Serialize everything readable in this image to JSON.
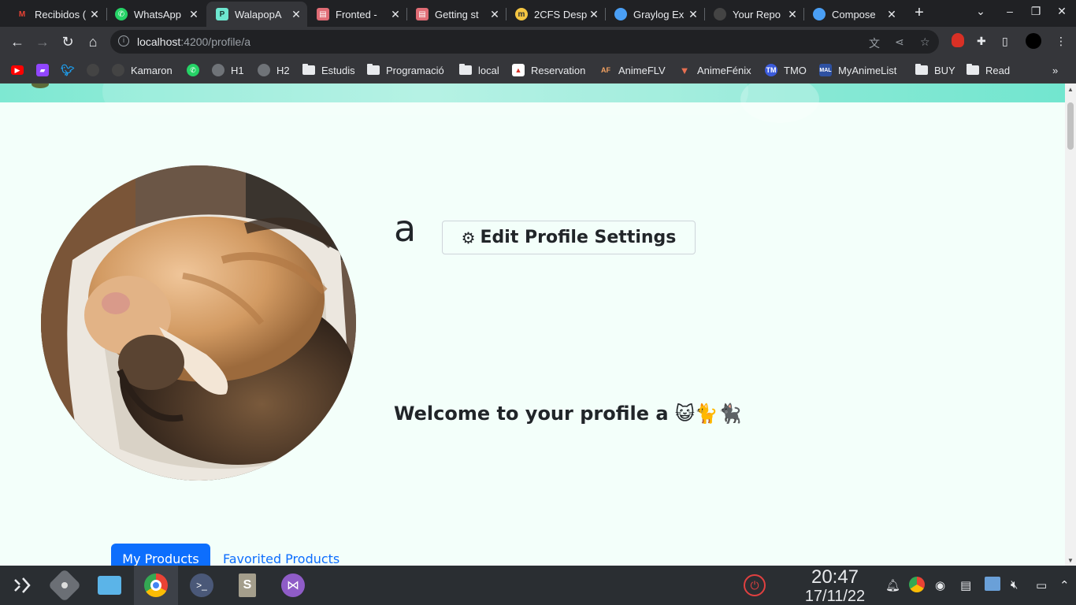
{
  "browser": {
    "tabs": [
      {
        "title": "Recibidos (",
        "icon": "gmail-icon",
        "color": "#ea4335",
        "active": false
      },
      {
        "title": "WhatsApp",
        "icon": "whatsapp-icon",
        "color": "#25d366",
        "active": false
      },
      {
        "title": "WalapopA",
        "icon": "walapop-icon",
        "color": "#6ee7d0",
        "active": true
      },
      {
        "title": "Fronted - ",
        "icon": "doc-icon",
        "color": "#e06c75",
        "active": false
      },
      {
        "title": "Getting st",
        "icon": "doc-icon",
        "color": "#e06c75",
        "active": false
      },
      {
        "title": "2CFS Desp",
        "icon": "moodle-icon",
        "color": "#f4c542",
        "active": false
      },
      {
        "title": "Graylog Ex",
        "icon": "compose-icon",
        "color": "#4a9ff5",
        "active": false
      },
      {
        "title": "Your Repo",
        "icon": "github-icon",
        "color": "#444444",
        "active": false
      },
      {
        "title": "Compose",
        "icon": "compose-icon",
        "color": "#4a9ff5",
        "active": false
      }
    ],
    "url_host": "localhost",
    "url_path": ":4200/profile/a"
  },
  "bookmarks": [
    {
      "label": "",
      "icon": "youtube-icon",
      "color": "#ff0000"
    },
    {
      "label": "",
      "icon": "twitch-icon",
      "color": "#9146ff"
    },
    {
      "label": "",
      "icon": "twitter-icon",
      "color": "#1da1f2"
    },
    {
      "label": "",
      "icon": "github-icon",
      "color": "#444444"
    },
    {
      "label": "Kamaron",
      "icon": "github-icon",
      "color": "#444444"
    },
    {
      "label": "",
      "icon": "whatsapp-icon",
      "color": "#25d366"
    },
    {
      "label": "H1",
      "icon": "globe-icon",
      "color": "#9aa0a6"
    },
    {
      "label": "H2",
      "icon": "globe-icon",
      "color": "#9aa0a6"
    },
    {
      "label": "Estudis",
      "icon": "folder-icon",
      "color": "#e8eaed"
    },
    {
      "label": "Programació",
      "icon": "folder-icon",
      "color": "#e8eaed"
    },
    {
      "label": "local",
      "icon": "folder-icon",
      "color": "#e8eaed"
    },
    {
      "label": "Reservation",
      "icon": "reservation-icon",
      "color": "#d93025"
    },
    {
      "label": "AnimeFLV",
      "icon": "animeflv-icon",
      "color": "#f4a261"
    },
    {
      "label": "AnimeFénix",
      "icon": "animefenix-icon",
      "color": "#e76f51"
    },
    {
      "label": "TMO",
      "icon": "tmo-icon",
      "color": "#3b5bdb"
    },
    {
      "label": "MyAnimeList",
      "icon": "mal-icon",
      "color": "#2e51a2"
    },
    {
      "label": "BUY",
      "icon": "folder-icon",
      "color": "#e8eaed"
    },
    {
      "label": "Read",
      "icon": "folder-icon",
      "color": "#e8eaed"
    }
  ],
  "profile": {
    "username": "a",
    "edit_button": "Edit Profile Settings",
    "welcome": "Welcome to your profile a 😺🐈🐈‍⬛"
  },
  "tabs": {
    "my_products": "My Products",
    "favorited_products": "Favorited Products"
  },
  "taskbar": {
    "time": "20:47",
    "date": "17/11/22"
  },
  "colors": {
    "primary": "#0d6efd",
    "page_bg": "#f3fffa",
    "hero": "#7ee8d2"
  }
}
